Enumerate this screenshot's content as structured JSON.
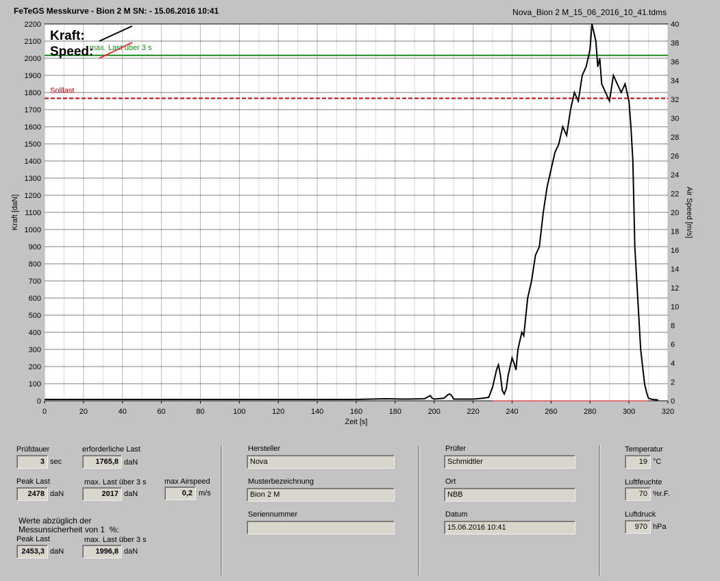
{
  "header": {
    "title": "FeTeGS Messkurve - Bion 2 M  SN:  - 15.06.2016 10:41",
    "filename": "Nova_Bion 2 M_15_06_2016_10_41.tdms"
  },
  "chart_data": {
    "type": "line",
    "xlabel": "Zeit [s]",
    "ylabel": "Kraft [daN]",
    "y2label": "Air Speed [m/s]",
    "xlim": [
      0,
      320
    ],
    "ylim": [
      0,
      2200
    ],
    "y2lim": [
      0,
      40
    ],
    "xticks": [
      "0",
      "20",
      "40",
      "60",
      "80",
      "100",
      "120",
      "140",
      "160",
      "180",
      "200",
      "220",
      "240",
      "260",
      "280",
      "300",
      "320"
    ],
    "yticks": [
      "0",
      "100",
      "200",
      "300",
      "400",
      "500",
      "600",
      "700",
      "800",
      "900",
      "1000",
      "1100",
      "1200",
      "1300",
      "1400",
      "1500",
      "1600",
      "1700",
      "1800",
      "1900",
      "2000",
      "2100",
      "2200"
    ],
    "y2ticks": [
      "0",
      "2",
      "4",
      "6",
      "8",
      "10",
      "12",
      "14",
      "16",
      "18",
      "20",
      "22",
      "24",
      "26",
      "28",
      "30",
      "32",
      "34",
      "36",
      "38",
      "40"
    ],
    "grid": true,
    "legend": {
      "kraft": "Kraft:",
      "speed": "Speed:",
      "position": "top-left"
    },
    "reference_lines": [
      {
        "label": "max. Last über  3 s",
        "value": 2017,
        "color": "#1a8a1a",
        "style": "solid"
      },
      {
        "label": "Solllast",
        "value": 1765.8,
        "color": "#c00000",
        "style": "dashed"
      }
    ],
    "series": [
      {
        "name": "Kraft",
        "color": "#000000",
        "x": [
          0,
          20,
          40,
          60,
          80,
          100,
          120,
          140,
          160,
          175,
          185,
          195,
          198,
          199,
          200,
          205,
          207,
          208,
          209,
          210,
          215,
          220,
          225,
          228,
          230,
          232,
          233,
          234,
          235,
          236,
          237,
          238,
          240,
          241,
          242,
          243,
          244,
          245,
          246,
          248,
          250,
          252,
          254,
          256,
          258,
          260,
          262,
          264,
          266,
          268,
          270,
          272,
          274,
          276,
          278,
          280,
          281,
          282,
          283,
          284,
          285,
          286,
          288,
          290,
          292,
          294,
          296,
          298,
          300,
          301,
          302,
          303,
          304,
          305,
          306,
          307,
          308,
          309,
          310,
          312,
          315
        ],
        "y": [
          8,
          8,
          8,
          8,
          8,
          8,
          8,
          8,
          8,
          12,
          10,
          12,
          30,
          15,
          10,
          15,
          35,
          40,
          30,
          10,
          10,
          10,
          15,
          20,
          80,
          180,
          210,
          150,
          60,
          40,
          70,
          150,
          250,
          220,
          180,
          300,
          350,
          400,
          380,
          600,
          700,
          850,
          900,
          1100,
          1250,
          1350,
          1450,
          1500,
          1600,
          1550,
          1700,
          1800,
          1750,
          1900,
          1950,
          2050,
          2200,
          2150,
          2100,
          1950,
          2000,
          1850,
          1800,
          1750,
          1900,
          1850,
          1800,
          1850,
          1750,
          1600,
          1400,
          900,
          700,
          500,
          300,
          200,
          100,
          50,
          15,
          8,
          5
        ]
      },
      {
        "name": "Speed",
        "color": "#e03030",
        "axis": "right",
        "x": [
          230,
          310
        ],
        "y": [
          0,
          0
        ]
      }
    ]
  },
  "panel": {
    "pruefdauer": {
      "label": "Prüfdauer",
      "value": "3",
      "unit": "sec"
    },
    "erforderliche_last": {
      "label": "erforderliche Last",
      "value": "1765,8",
      "unit": "daN"
    },
    "peak_last": {
      "label": "Peak Last",
      "value": "2478",
      "unit": "daN"
    },
    "max_last": {
      "label": "max. Last über  3 s",
      "value": "2017",
      "unit": "daN"
    },
    "max_airspeed": {
      "label": "max Airspeed",
      "value": "0,2",
      "unit": "m/s"
    },
    "note": "Werte abzüglich der\nMessunsicherheit von 1  %:",
    "peak_last_corr": {
      "label": "Peak Last",
      "value": "2453,3",
      "unit": "daN"
    },
    "max_last_corr": {
      "label": "max. Last über  3 s",
      "value": "1996,8",
      "unit": "daN"
    },
    "hersteller": {
      "label": "Hersteller",
      "value": "Nova"
    },
    "musterbezeichnung": {
      "label": "Musterbezeichnung",
      "value": "Bion 2 M"
    },
    "seriennummer": {
      "label": "Seriennummer",
      "value": ""
    },
    "pruefer": {
      "label": "Prüfer",
      "value": "Schmidtler"
    },
    "ort": {
      "label": "Ort",
      "value": "NBB"
    },
    "datum": {
      "label": "Datum",
      "value": "15.06.2016 10:41"
    },
    "temperatur": {
      "label": "Temperatur",
      "value": "19",
      "unit": "°C"
    },
    "luftfeuchte": {
      "label": "Luftfeuchte",
      "value": "70",
      "unit": "%r.F."
    },
    "luftdruck": {
      "label": "Luftdruck",
      "value": "970",
      "unit": "hPa"
    }
  }
}
